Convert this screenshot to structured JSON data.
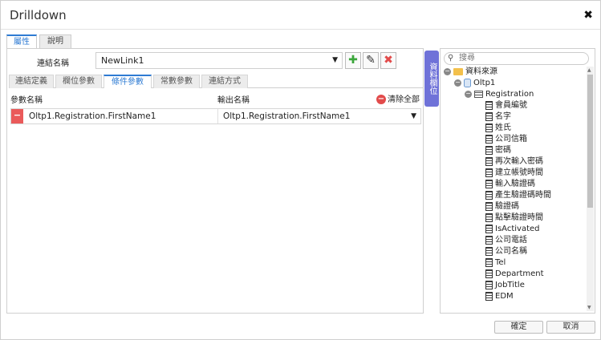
{
  "window": {
    "title": "Drilldown",
    "close_glyph": "✖"
  },
  "top_tabs": [
    {
      "label": "屬性",
      "active": true
    },
    {
      "label": "說明",
      "active": false
    }
  ],
  "link": {
    "label": "連結名稱",
    "value": "NewLink1"
  },
  "toolbar": {
    "add_glyph": "✚",
    "edit_glyph": "✎",
    "delete_glyph": "✖"
  },
  "sub_tabs": [
    {
      "label": "連結定義",
      "active": false
    },
    {
      "label": "欄位參數",
      "active": false
    },
    {
      "label": "條件參數",
      "active": true
    },
    {
      "label": "常數參數",
      "active": false
    },
    {
      "label": "連結方式",
      "active": false
    }
  ],
  "params": {
    "header_param": "參數名稱",
    "header_output": "輸出名稱",
    "clear_all": "清除全部",
    "rows": [
      {
        "param": "Oltp1.Registration.FirstName1",
        "output": "Oltp1.Registration.FirstName1"
      }
    ]
  },
  "side_tab": {
    "label": "資料欄位"
  },
  "search": {
    "placeholder": "搜尋"
  },
  "tree": {
    "root": "資料來源",
    "db": "Oltp1",
    "table": "Registration",
    "fields": [
      "會員編號",
      "名字",
      "姓氏",
      "公司信箱",
      "密碼",
      "再次輸入密碼",
      "建立帳號時間",
      "輸入驗證碼",
      "產生驗證碼時間",
      "驗證碼",
      "點擊驗證時間",
      "IsActivated",
      "公司電話",
      "公司名稱",
      "Tel",
      "Department",
      "JobTitle",
      "EDM"
    ]
  },
  "footer": {
    "ok": "確定",
    "cancel": "取消"
  },
  "colors": {
    "accent": "#2e7bd3",
    "side_tab": "#6f72d8",
    "danger": "#e24b4b",
    "add": "#3aa63a"
  }
}
